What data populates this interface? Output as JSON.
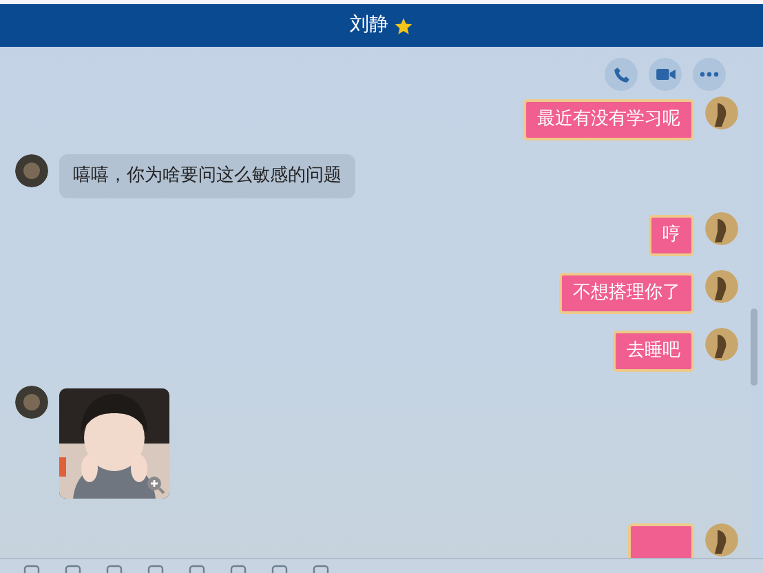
{
  "window": {
    "title": "刘静"
  },
  "messages": [
    {
      "sent": true,
      "kind": "text",
      "text": "最近有没有学习呢"
    },
    {
      "sent": false,
      "kind": "text",
      "text": "嘻嘻，你为啥要问这么敏感的问题"
    },
    {
      "sent": true,
      "kind": "text",
      "text": "哼"
    },
    {
      "sent": true,
      "kind": "text",
      "text": "不想搭理你了"
    },
    {
      "sent": true,
      "kind": "text",
      "text": "去睡吧"
    },
    {
      "sent": false,
      "kind": "picture"
    },
    {
      "sent": true,
      "kind": "cut"
    }
  ]
}
